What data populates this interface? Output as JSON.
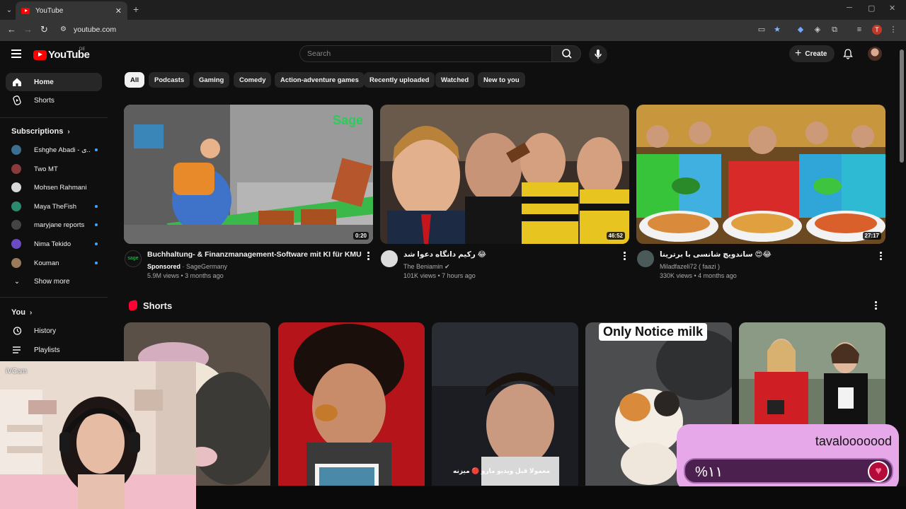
{
  "browser": {
    "tab_title": "YouTube",
    "url": "youtube.com",
    "profile_initial": "T"
  },
  "header": {
    "logo_text": "YouTube",
    "country_code": "DE",
    "search_placeholder": "Search",
    "create_label": "Create"
  },
  "sidebar": {
    "home": "Home",
    "shorts": "Shorts",
    "subscriptions_label": "Subscriptions",
    "subscriptions": [
      {
        "name": "Eshghe Abadi - ی..",
        "color": "#3b6e8f",
        "live": true
      },
      {
        "name": "Two MT",
        "color": "#8a3a3a",
        "live": false
      },
      {
        "name": "Mohsen Rahmani",
        "color": "#d9d9d9",
        "live": false
      },
      {
        "name": "Maya TheFish",
        "color": "#2b8a6e",
        "live": true
      },
      {
        "name": "maryjane reports",
        "color": "#444444",
        "live": true
      },
      {
        "name": "Nima Tekido",
        "color": "#6a4bc2",
        "live": true
      },
      {
        "name": "Kouman",
        "color": "#9b7a5a",
        "live": true
      }
    ],
    "show_more": "Show more",
    "you_label": "You",
    "history": "History",
    "playlists": "Playlists"
  },
  "chips": [
    "All",
    "Podcasts",
    "Gaming",
    "Comedy",
    "Action-adventure games",
    "Recently uploaded",
    "Watched",
    "New to you"
  ],
  "videos": [
    {
      "title": "Buchhaltung- & Finanzmanagement-Software mit KI für KMU",
      "sponsored": "Sponsored",
      "channel": "SageGermany",
      "meta": "5.9M views • 3 months ago",
      "duration": "0:20",
      "thumb_text": "Sage"
    },
    {
      "title": "رکیم دانگاه دعوا شد 😂",
      "channel": "The Beniamin",
      "meta": "101K views • 7 hours ago",
      "duration": "46:52"
    },
    {
      "title": "ساندویچ شانسی با برترینا 😍😂",
      "channel": "Miladfazeli72 ( faazi )",
      "meta": "330K views • 4 months ago",
      "duration": "27:17"
    }
  ],
  "shorts": {
    "title": "Shorts",
    "caption": "Only Notice milk",
    "arabic_caption": "معمولا قبل ویدیو مارو 🔴 میزنه"
  },
  "webcam": {
    "tag": "iVCam"
  },
  "donation": {
    "name": "tavalooooood",
    "value": "%۱۱"
  },
  "colors": {
    "background": "#0f0f0f",
    "brand_red": "#ff0000",
    "widget_pink": "#e7a8ea"
  }
}
